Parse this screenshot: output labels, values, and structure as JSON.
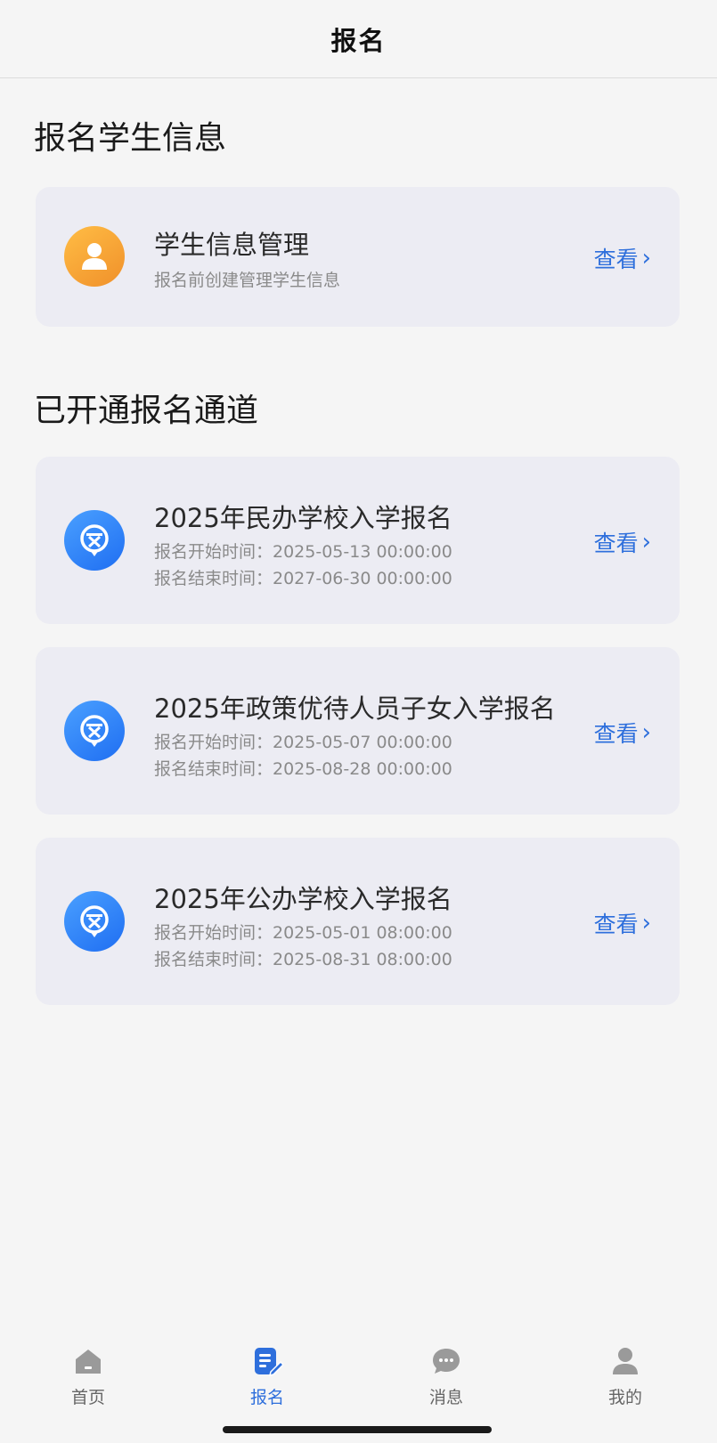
{
  "header": {
    "title": "报名"
  },
  "student_section": {
    "title": "报名学生信息",
    "card": {
      "icon": "user-icon",
      "title": "学生信息管理",
      "subtitle": "报名前创建管理学生信息",
      "action": "查看",
      "chevron": "›"
    }
  },
  "channels_section": {
    "title": "已开通报名通道",
    "items": [
      {
        "icon": "document-badge-icon",
        "title": "2025年民办学校入学报名",
        "start": "报名开始时间：2025-05-13 00:00:00",
        "end": "报名结束时间：2027-06-30 00:00:00",
        "action": "查看",
        "chevron": "›"
      },
      {
        "icon": "document-badge-icon",
        "title": "2025年政策优待人员子女入学报名",
        "start": "报名开始时间：2025-05-07 00:00:00",
        "end": "报名结束时间：2025-08-28 00:00:00",
        "action": "查看",
        "chevron": "›"
      },
      {
        "icon": "document-badge-icon",
        "title": "2025年公办学校入学报名",
        "start": "报名开始时间：2025-05-01 08:00:00",
        "end": "报名结束时间：2025-08-31 08:00:00",
        "action": "查看",
        "chevron": "›"
      }
    ]
  },
  "tabbar": {
    "active": "报名",
    "tabs": [
      {
        "label": "首页",
        "icon": "home-icon"
      },
      {
        "label": "报名",
        "icon": "form-edit-icon"
      },
      {
        "label": "消息",
        "icon": "chat-bubble-icon"
      },
      {
        "label": "我的",
        "icon": "person-icon"
      }
    ]
  },
  "colors": {
    "accent": "#2e6fdc",
    "card_bg": "#ececf3",
    "page_bg": "#f5f5f5",
    "orange": "#f5a53a",
    "blue_icon": "#2a7bf6"
  }
}
